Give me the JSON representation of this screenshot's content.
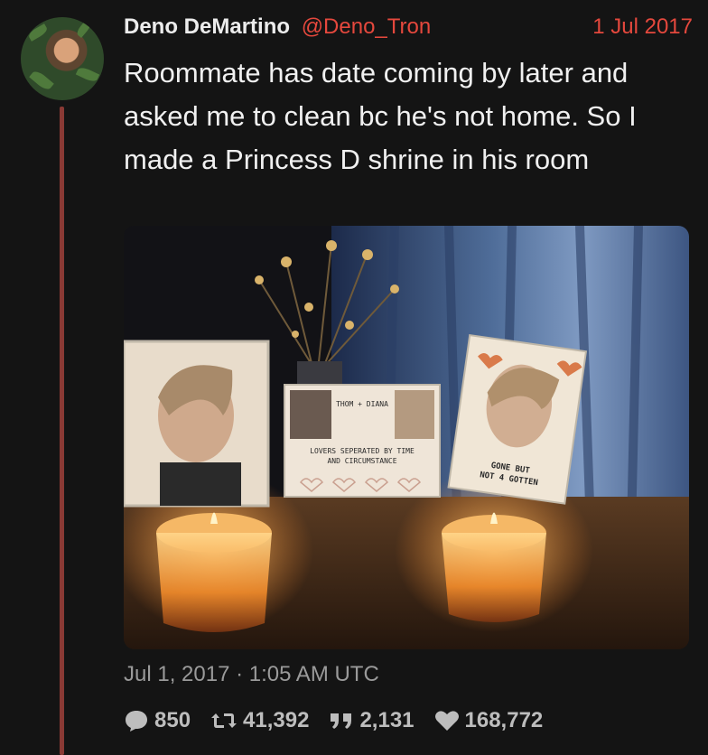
{
  "tweet": {
    "author_name": "Deno DeMartino",
    "author_handle": "@Deno_Tron",
    "date_short": "1 Jul 2017",
    "text": "Roommate has date coming by later and asked me to clean bc he's not home. So I made a Princess D shrine in his room",
    "timestamp": "Jul 1, 2017 · 1:05 AM UTC"
  },
  "photo": {
    "card_title": "THOM + DIANA",
    "card_caption_line1": "LOVERS SEPERATED BY TIME",
    "card_caption_line2": "AND CIRCUMSTANCE",
    "right_caption_line1": "GONE BUT",
    "right_caption_line2": "NOT 4 GOTTEN"
  },
  "stats": {
    "replies": "850",
    "retweets": "41,392",
    "quotes": "2,131",
    "likes": "168,772"
  },
  "colors": {
    "background": "#141414",
    "accent_red": "#e5483d",
    "thread_line": "#8a3a35"
  },
  "icons": [
    "reply-icon",
    "retweet-icon",
    "quote-icon",
    "heart-icon"
  ]
}
